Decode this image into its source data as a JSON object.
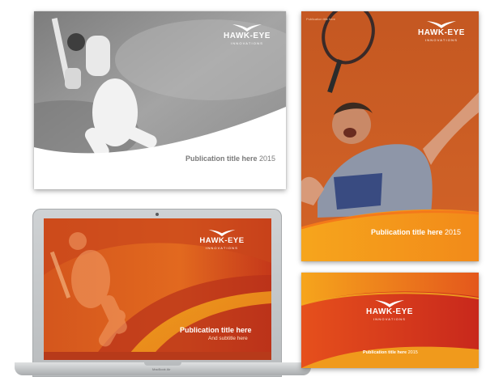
{
  "brand": {
    "name": "HAWK-EYE",
    "tagline": "INNOVATIONS"
  },
  "colors": {
    "orange": "#e8631e",
    "deep_orange": "#c8401a",
    "yellow": "#f7b21b",
    "title_gray": "#7a7a7a"
  },
  "mockups": [
    {
      "variant": "landscape-white-grayscale",
      "title": "Publication title here",
      "year": "2015"
    },
    {
      "variant": "portrait-orange",
      "small_text": "Publication title here",
      "title": "Publication title here",
      "year": "2015"
    },
    {
      "variant": "laptop-screen",
      "title": "Publication title here",
      "subtitle": "And subtitle here",
      "device_label": "MacBook Air"
    },
    {
      "variant": "banner-orange",
      "title": "Publication title here",
      "year": "2015"
    }
  ]
}
